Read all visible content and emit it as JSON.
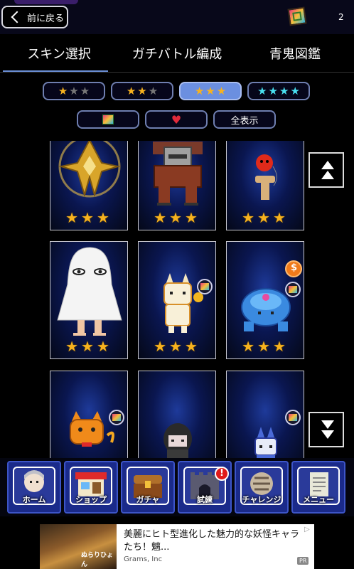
{
  "header": {
    "back_label": "前に戻る",
    "count": "2",
    "pic_icon": "picture-icon"
  },
  "tabs": [
    {
      "label": "スキン選択",
      "active": true
    },
    {
      "label": "ガチバトル編成",
      "active": false
    },
    {
      "label": "青鬼図鑑",
      "active": false
    }
  ],
  "rarity_filters": [
    {
      "stars": 3,
      "filled": 1,
      "color": "gold",
      "selected": false
    },
    {
      "stars": 3,
      "filled": 2,
      "color": "gold",
      "selected": false
    },
    {
      "stars": 3,
      "filled": 3,
      "color": "gold",
      "selected": true
    },
    {
      "stars": 4,
      "filled": 4,
      "color": "cyan",
      "selected": false
    }
  ],
  "type_filters": {
    "picture_icon": "picture-icon",
    "heart_icon": "heart-icon",
    "show_all_label": "全表示"
  },
  "skins": [
    {
      "name": "golden-dragon",
      "stars": "★★★"
    },
    {
      "name": "red-robot",
      "stars": "★★★"
    },
    {
      "name": "kendama",
      "stars": "★★★"
    },
    {
      "name": "ghost-blanket",
      "stars": "★★★"
    },
    {
      "name": "white-fox",
      "stars": "★★★"
    },
    {
      "name": "blue-turtle",
      "stars": "★★★"
    },
    {
      "name": "orange-cat",
      "stars": ""
    },
    {
      "name": "dark-hair-girl",
      "stars": ""
    },
    {
      "name": "blue-knight",
      "stars": ""
    }
  ],
  "nav": [
    {
      "label": "ホーム",
      "icon": "home-character-icon",
      "alert": false
    },
    {
      "label": "ショップ",
      "icon": "shop-icon",
      "alert": false
    },
    {
      "label": "ガチャ",
      "icon": "treasure-chest-icon",
      "alert": false
    },
    {
      "label": "試練",
      "icon": "castle-gate-icon",
      "alert": true,
      "alert_text": "!"
    },
    {
      "label": "チャレンジ",
      "icon": "challenge-icon",
      "alert": false
    },
    {
      "label": "メニュー",
      "icon": "document-icon",
      "alert": false
    }
  ],
  "ad": {
    "headline": "美麗にヒト型進化した魅力的な妖怪キャラたち！魑...",
    "advertiser": "Grams, Inc",
    "pr_label": "PR",
    "logo_text": "ぬらりひょん"
  },
  "colors": {
    "accent": "#6b8fe0",
    "nav_bg": "#1a2a8a",
    "star_gold": "#f7b21e",
    "star_cyan": "#49e0f0"
  }
}
